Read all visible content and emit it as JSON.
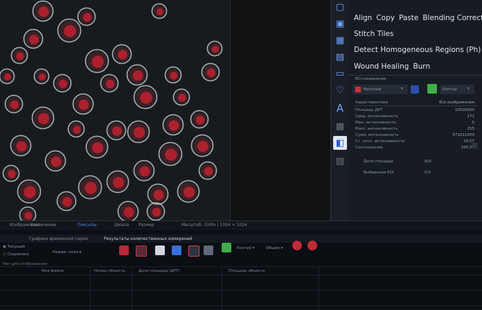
{
  "menu": {
    "row1": [
      "Align",
      "Copy",
      "Paste",
      "Blending Correction"
    ],
    "row2": "Stitch Tiles",
    "row3": "Detect Homogeneous Regions (Ph)",
    "row4": [
      "Wound Healing",
      "Burn"
    ]
  },
  "panel": {
    "section_label": "BD-соединение",
    "selector_value": "Красный",
    "selector2_value": "Контур",
    "header_left": "Характеристика",
    "header_right": "Все изображения",
    "properties": [
      {
        "label": "Площадь ДРТ",
        "value": "10500000"
      },
      {
        "label": "Сред. интенсивность",
        "value": "171"
      },
      {
        "label": "Мин. интенсивность",
        "value": "0"
      },
      {
        "label": "Макс. интенсивность",
        "value": "255"
      },
      {
        "label": "Сумм. интенсивность",
        "value": "571011000"
      },
      {
        "label": "Ст. откл. интенсивности",
        "value": "19.07"
      },
      {
        "label": "Соотношение",
        "value": "100.00"
      }
    ],
    "area_label": "Доля площади",
    "area_value": "N/A",
    "selected_label": "Выбранная ROI",
    "selected_value": "0/0"
  },
  "tabs": [
    "Изображение",
    "Увеличение",
    "Пикселы",
    "Шкала",
    "Размер"
  ],
  "status": "Масштаб: 100% | 1024 × 1024",
  "bottom_tabs": [
    "Графики временной серии",
    "Результаты количественных измерений"
  ],
  "options": [
    "Текущий",
    "Сохранено"
  ],
  "mode_label": "Режим: поля",
  "contour_label": "Контур",
  "general_label": "Общие",
  "column_headers": [
    "Имя файла",
    "Номер объекта",
    "Доля площади (ДРТ)",
    "Площадь объекта"
  ],
  "results_hint": "Нет для отображения"
}
